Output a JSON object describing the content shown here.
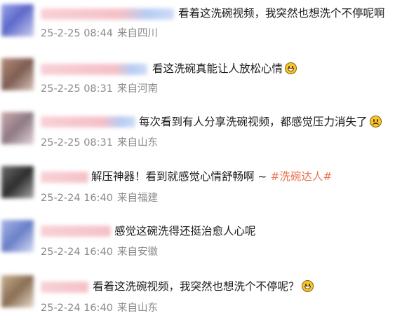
{
  "comments": [
    {
      "text": "看着这洗碗视频，我突然也想洗个不停呢啊",
      "time": "25-2-25 08:44",
      "location": "来自四川",
      "emoji": "",
      "hashtag": ""
    },
    {
      "text": "看这洗碗真能让人放松心情",
      "time": "25-2-25 08:31",
      "location": "来自河南",
      "emoji": "grin-emoji",
      "hashtag": ""
    },
    {
      "text": "每次看到有人分享洗碗视频，都感觉压力消失了",
      "time": "25-2-25 08:31",
      "location": "来自山东",
      "emoji": "sad-emoji",
      "hashtag": ""
    },
    {
      "text": "解压神器！看到就感觉心情舒畅啊 ~ ",
      "time": "25-2-24 16:40",
      "location": "来自福建",
      "emoji": "",
      "hashtag": "#洗碗达人#"
    },
    {
      "text": "感觉这碗洗得还挺治愈人心呢",
      "time": "25-2-24 16:40",
      "location": "来自安徽",
      "emoji": "",
      "hashtag": ""
    },
    {
      "text": "看着这洗碗视频，我突然也想洗个不停呢？",
      "time": "25-2-24 16:40",
      "location": "来自山东",
      "emoji": "laugh-emoji",
      "hashtag": ""
    }
  ],
  "colors": {
    "text": "#1a1a1a",
    "meta": "#8a8a8a",
    "hashtag": "#eb7350"
  }
}
